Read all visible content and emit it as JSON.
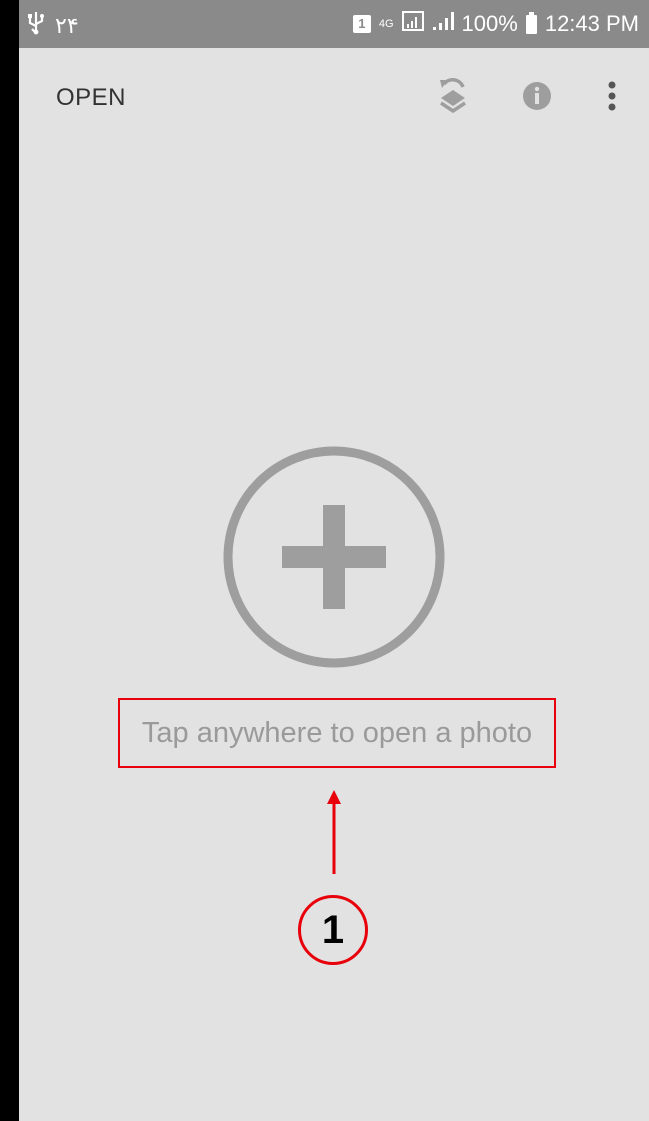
{
  "status_bar": {
    "usb_icon": "usb-icon",
    "notification_count": "۲۴",
    "sim_slot": "1",
    "network_type": "4G",
    "battery_percent": "100%",
    "time": "12:43 PM"
  },
  "app_bar": {
    "open_label": "OPEN",
    "icons": [
      "layers-sync-icon",
      "info-icon",
      "overflow-menu-icon"
    ]
  },
  "main": {
    "add_icon": "add-circle-icon",
    "hint": "Tap anywhere to open a photo"
  },
  "annotation": {
    "marker_number": "1",
    "color": "#e8000b"
  },
  "colors": {
    "background": "#e2e2e2",
    "status_bar": "#8a8a8a",
    "icon_gray": "#9e9e9e",
    "hint_text": "#9a9a9a",
    "annotation_red": "#e8000b"
  }
}
